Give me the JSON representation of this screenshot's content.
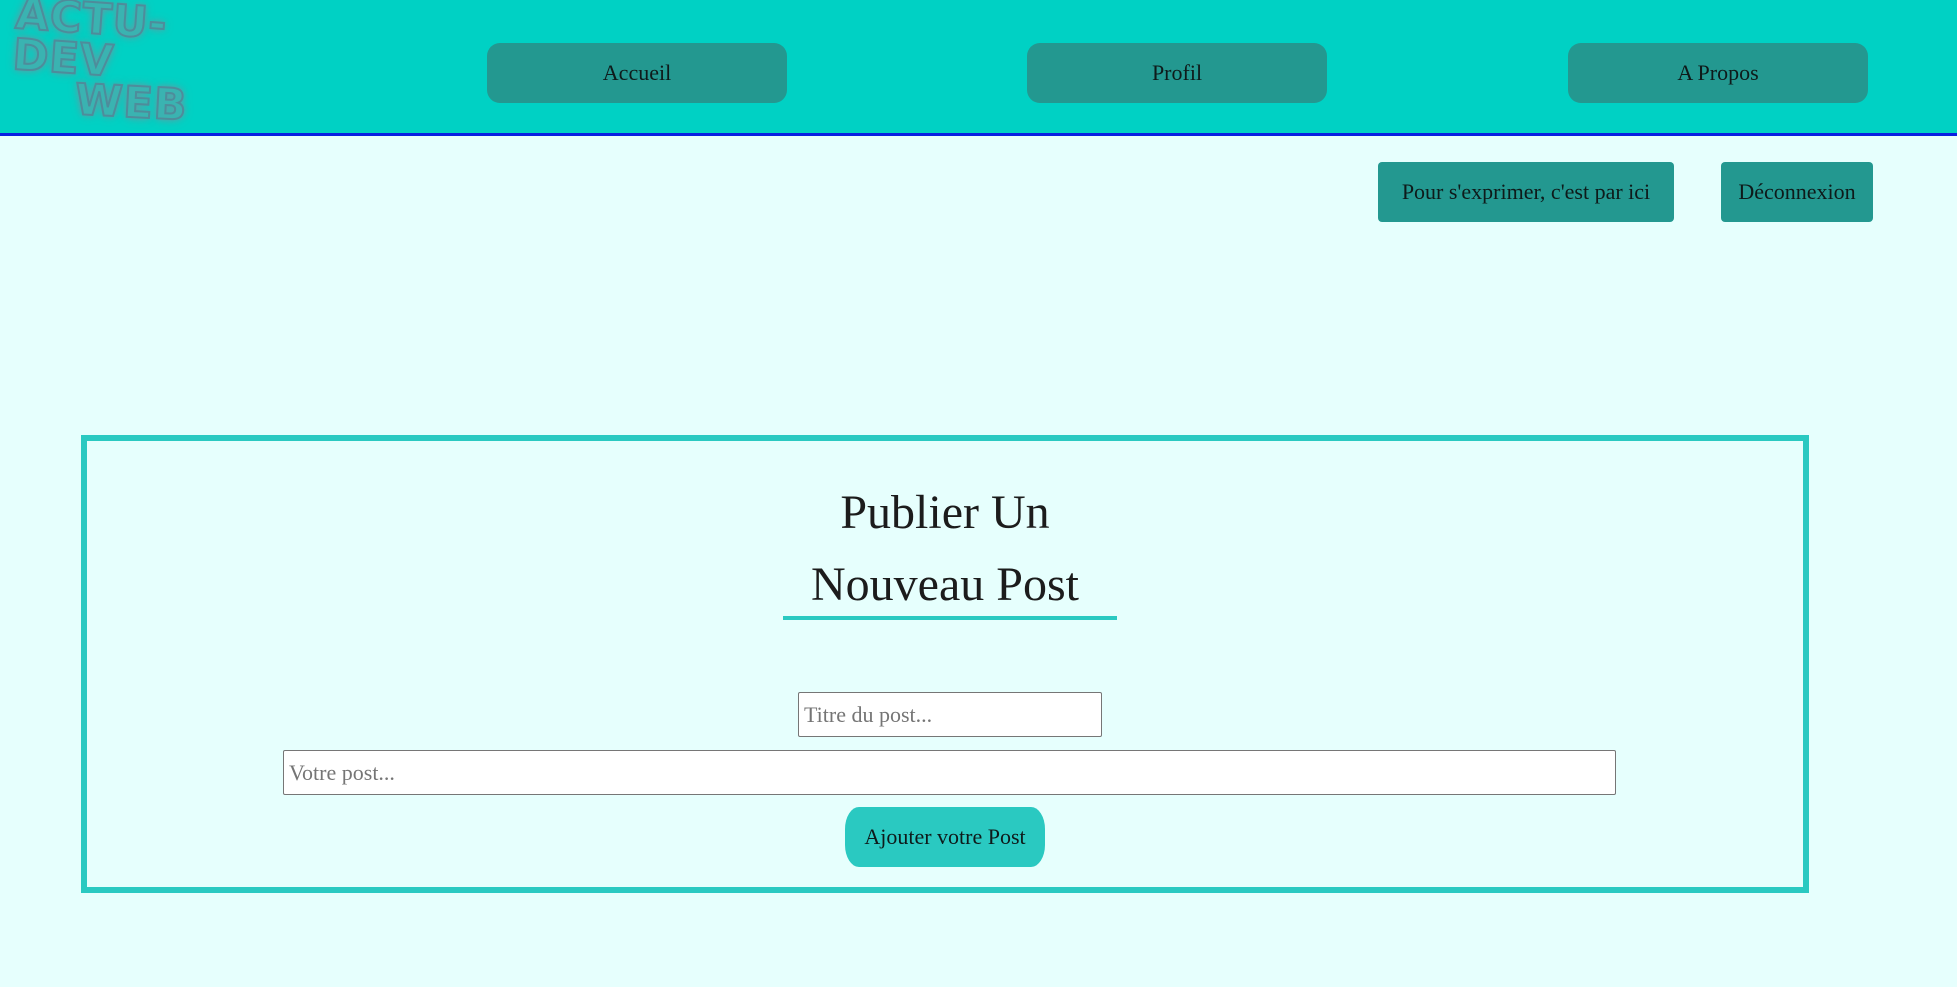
{
  "header": {
    "logo": {
      "line1": "ACTU-DEV",
      "line2": "WEB"
    },
    "nav": {
      "accueil": "Accueil",
      "profil": "Profil",
      "apropos": "A Propos"
    }
  },
  "actions": {
    "exprimer": "Pour s'exprimer, c'est par ici",
    "deconnexion": "Déconnexion"
  },
  "post_form": {
    "title_line1": "Publier Un",
    "title_line2": "Nouveau Post",
    "title_placeholder": "Titre du post...",
    "post_placeholder": "Votre post...",
    "submit_label": "Ajouter votre Post"
  },
  "colors": {
    "header_bg": "#00d1c4",
    "header_border": "#0a1fe0",
    "button_bg": "#239890",
    "accent": "#2ac9c1",
    "page_bg": "#e6fffd"
  }
}
